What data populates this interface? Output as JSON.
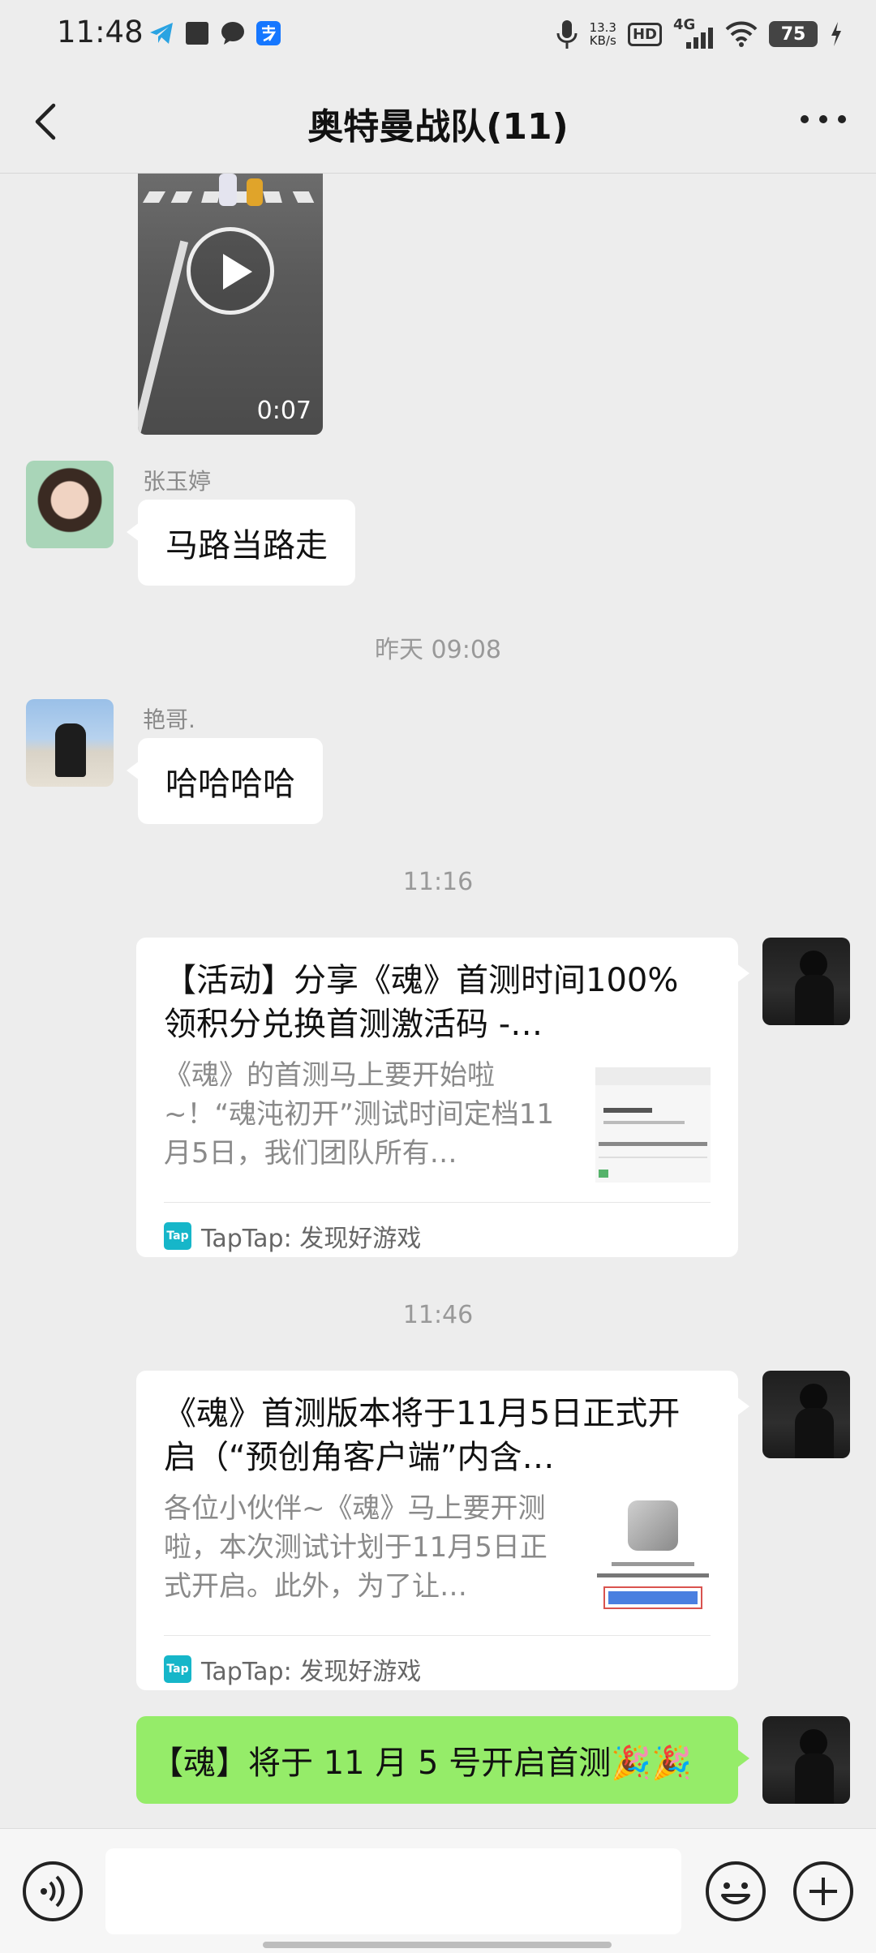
{
  "status_bar": {
    "time": "11:48",
    "net_speed_value": "13.3",
    "net_speed_unit": "KB/s",
    "hd": "HD",
    "signal": "4G",
    "battery": "75"
  },
  "nav": {
    "title": "奥特曼战队(11)"
  },
  "messages": {
    "video_duration": "0:07",
    "msg1_sender": "张玉婷",
    "msg1_text": "马路当路走",
    "time1": "昨天 09:08",
    "msg2_sender": "艳哥.",
    "msg2_text": "哈哈哈哈",
    "time2": "11:16",
    "card1_title": "【活动】分享《魂》首测时间100%领积分兑换首测激活码 -…",
    "card1_desc": "《魂》的首测马上要开始啦~！“魂沌初开”测试时间定档11月5日，我们团队所有…",
    "card1_source": "TapTap: 发现好游戏",
    "time3": "11:46",
    "card2_title": "《魂》首测版本将于11月5日正式开启（“预创角客户端”内含…",
    "card2_desc": "各位小伙伴~《魂》马上要开测啦，本次测试计划于11月5日正式开启。此外，为了让…",
    "card2_source": "TapTap: 发现好游戏",
    "msg3_text": "【魂】将于 11 月 5 号开启首测🎉🎉",
    "tap_icon_label": "Tap"
  },
  "colors": {
    "background": "#ededed",
    "green_bubble": "#95ec69",
    "taptap_accent": "#16b6c9"
  }
}
